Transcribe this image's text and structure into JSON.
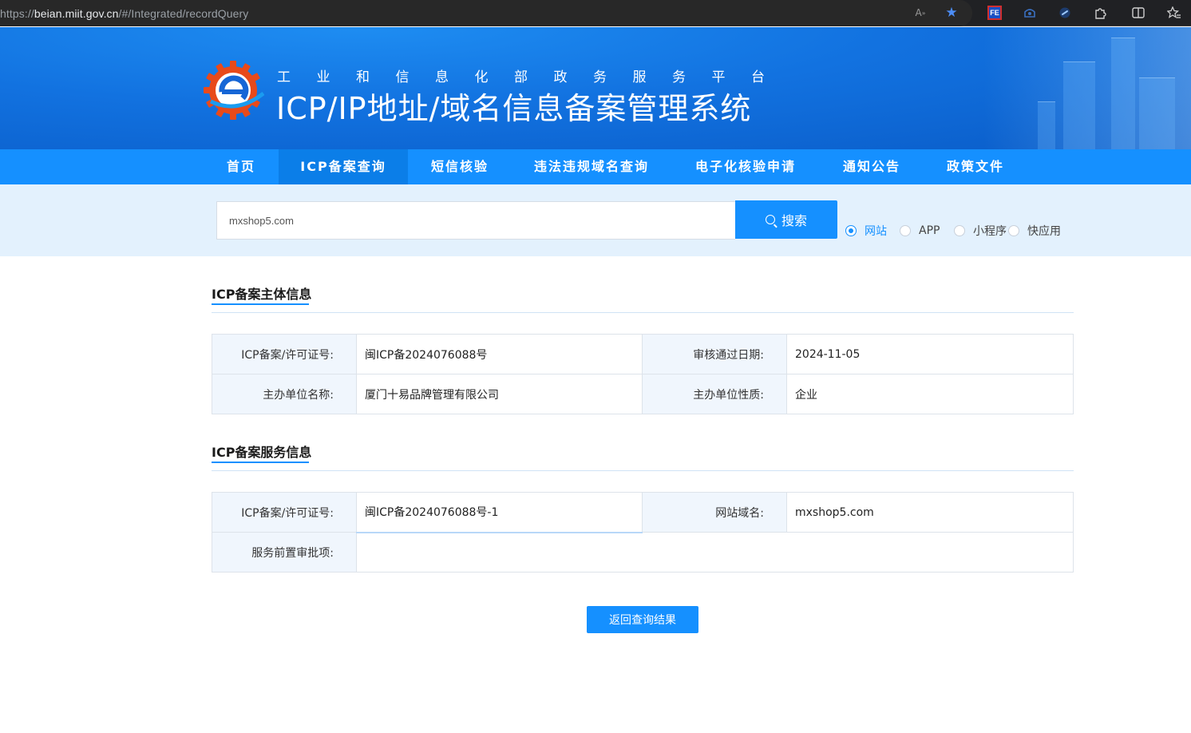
{
  "browser": {
    "url_scheme": "https://",
    "url_host": "beian.miit.gov.cn",
    "url_path": "/#/Integrated/recordQuery",
    "fe_icon_label": "FE"
  },
  "header": {
    "subtitle": "工业和信息化部政务服务平台",
    "title": "ICP/IP地址/域名信息备案管理系统"
  },
  "nav": {
    "items": [
      {
        "label": "首页"
      },
      {
        "label": "ICP备案查询"
      },
      {
        "label": "短信核验"
      },
      {
        "label": "违法违规域名查询"
      },
      {
        "label": "电子化核验申请"
      },
      {
        "label": "通知公告"
      },
      {
        "label": "政策文件"
      }
    ],
    "active_index": 1
  },
  "search": {
    "value": "mxshop5.com",
    "button_label": "搜索",
    "options": [
      {
        "label": "网站",
        "checked": true
      },
      {
        "label": "APP",
        "checked": false
      },
      {
        "label": "小程序",
        "checked": false
      },
      {
        "label": "快应用",
        "checked": false
      }
    ]
  },
  "subject_section": {
    "title": "ICP备案主体信息",
    "rows": [
      {
        "label1": "ICP备案/许可证号:",
        "value1": "闽ICP备2024076088号",
        "label2": "审核通过日期:",
        "value2": "2024-11-05"
      },
      {
        "label1": "主办单位名称:",
        "value1": "厦门十易品牌管理有限公司",
        "label2": "主办单位性质:",
        "value2": "企业"
      }
    ]
  },
  "service_section": {
    "title": "ICP备案服务信息",
    "row1": {
      "label1": "ICP备案/许可证号:",
      "value1": "闽ICP备2024076088号-1",
      "label2": "网站域名:",
      "value2": "mxshop5.com"
    },
    "row2": {
      "label": "服务前置审批项:",
      "value": ""
    }
  },
  "back_button_label": "返回查询结果",
  "colors": {
    "primary": "#1590ff",
    "nav_active": "#0b7ee8",
    "search_strip_bg": "#e3f1fd",
    "label_cell_bg": "#f0f6fd"
  }
}
